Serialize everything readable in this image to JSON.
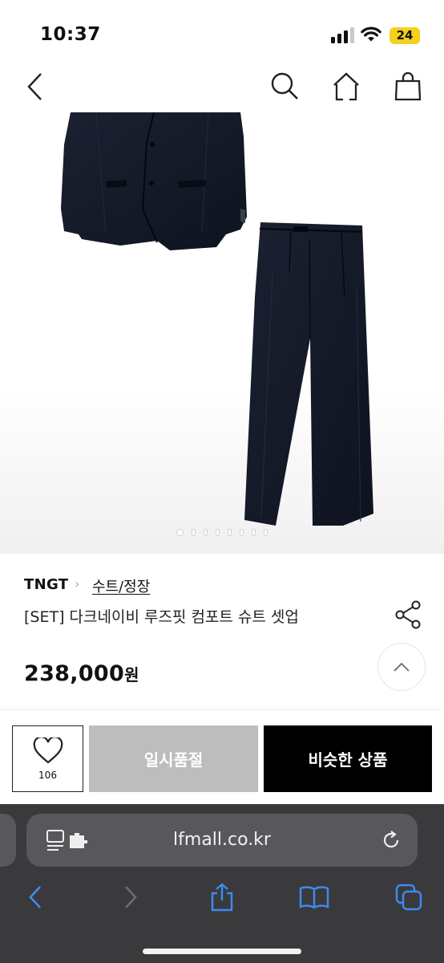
{
  "status_bar": {
    "time": "10:37",
    "battery": "24"
  },
  "header": {
    "icons": [
      "back-chevron-icon",
      "search-icon",
      "home-icon",
      "shopping-bag-icon"
    ]
  },
  "carousel": {
    "total": 8,
    "active_index": 0
  },
  "product": {
    "brand": "TNGT",
    "breadcrumb_separator": "›",
    "category": "수트/정장",
    "title": "[SET] 다크네이비 루즈핏 컴포트 슈트 셋업",
    "price": "238,000",
    "price_unit": "원"
  },
  "actions": {
    "like_count": "106",
    "soldout_label": "일시품절",
    "similar_label": "비슷한 상품"
  },
  "browser": {
    "url": "lfmall.co.kr",
    "toolbar": [
      "back-icon",
      "forward-icon",
      "share-icon",
      "bookmarks-icon",
      "tabs-icon"
    ]
  },
  "colors": {
    "accent": "#000000",
    "soldout": "#bdbdbd",
    "garment": "#141927",
    "browser_bg": "#3a3a3d",
    "browser_field": "#58585c",
    "safari_blue": "#3d8bf2",
    "battery": "#f4d01f"
  }
}
